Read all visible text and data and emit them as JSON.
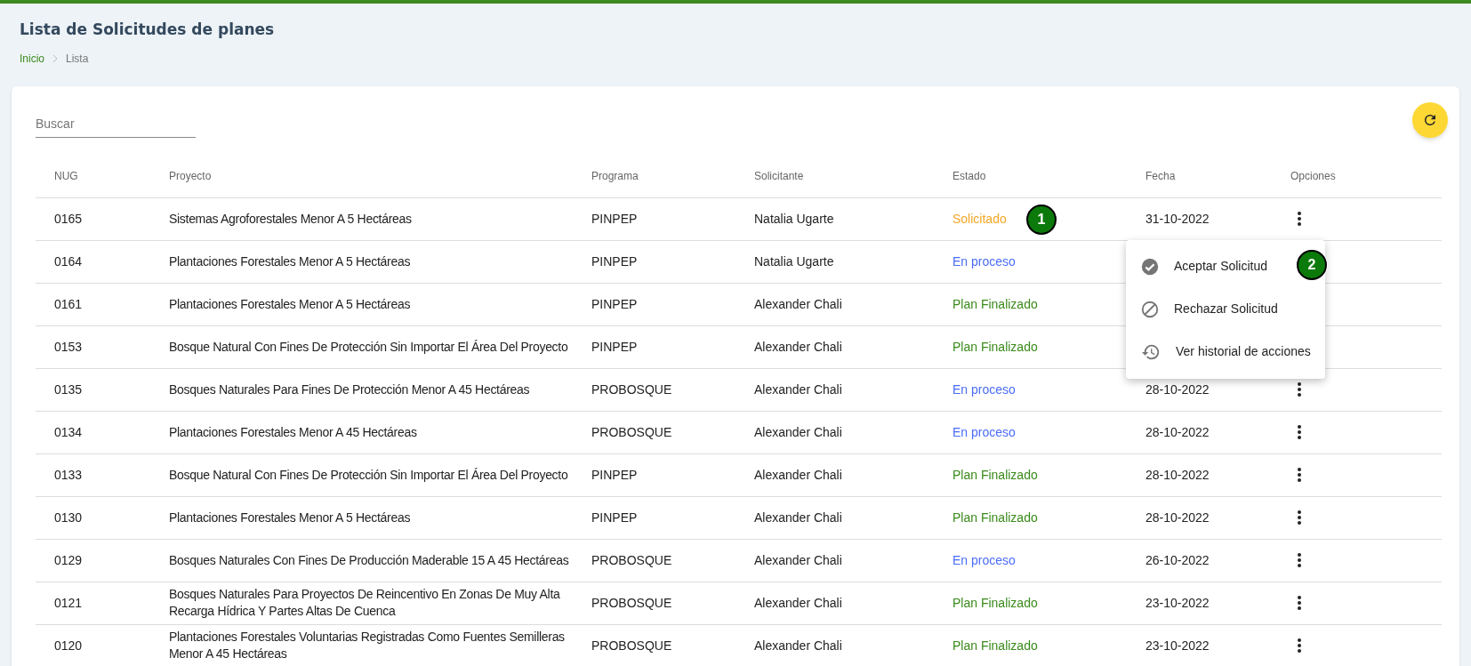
{
  "page": {
    "title": "Lista de Solicitudes de planes",
    "breadcrumb": [
      {
        "label": "Inicio",
        "kind": "link"
      },
      {
        "label": "Lista",
        "kind": "current"
      }
    ]
  },
  "search": {
    "placeholder": "Buscar"
  },
  "table": {
    "columns": [
      "NUG",
      "Proyecto",
      "Programa",
      "Solicitante",
      "Estado",
      "Fecha",
      "Opciones"
    ],
    "rows": [
      {
        "nug": "0165",
        "proyecto": "Sistemas Agroforestales Menor A 5 Hectáreas",
        "programa": "PINPEP",
        "solicitante": "Natalia Ugarte",
        "estado": {
          "label": "Solicitado",
          "kind": "solicitado"
        },
        "fecha": "31-10-2022"
      },
      {
        "nug": "0164",
        "proyecto": "Plantaciones Forestales Menor A 5 Hectáreas",
        "programa": "PINPEP",
        "solicitante": "Natalia Ugarte",
        "estado": {
          "label": "En proceso",
          "kind": "proceso"
        }
      },
      {
        "nug": "0161",
        "proyecto": "Plantaciones Forestales Menor A 5 Hectáreas",
        "programa": "PINPEP",
        "solicitante": "Alexander Chali",
        "estado": {
          "label": "Plan Finalizado",
          "kind": "finalizado"
        }
      },
      {
        "nug": "0153",
        "proyecto": "Bosque Natural Con Fines De Protección Sin Importar El Área Del Proyecto",
        "programa": "PINPEP",
        "solicitante": "Alexander Chali",
        "estado": {
          "label": "Plan Finalizado",
          "kind": "finalizado"
        }
      },
      {
        "nug": "0135",
        "proyecto": "Bosques Naturales Para Fines De Protección Menor A 45 Hectáreas",
        "programa": "PROBOSQUE",
        "solicitante": "Alexander Chali",
        "estado": {
          "label": "En proceso",
          "kind": "proceso"
        },
        "fecha": "28-10-2022"
      },
      {
        "nug": "0134",
        "proyecto": "Plantaciones Forestales Menor A 45 Hectáreas",
        "programa": "PROBOSQUE",
        "solicitante": "Alexander Chali",
        "estado": {
          "label": "En proceso",
          "kind": "proceso"
        },
        "fecha": "28-10-2022"
      },
      {
        "nug": "0133",
        "proyecto": "Bosque Natural Con Fines De Protección Sin Importar El Área Del Proyecto",
        "programa": "PINPEP",
        "solicitante": "Alexander Chali",
        "estado": {
          "label": "Plan Finalizado",
          "kind": "finalizado"
        },
        "fecha": "28-10-2022"
      },
      {
        "nug": "0130",
        "proyecto": "Plantaciones Forestales Menor A 5 Hectáreas",
        "programa": "PINPEP",
        "solicitante": "Alexander Chali",
        "estado": {
          "label": "Plan Finalizado",
          "kind": "finalizado"
        },
        "fecha": "28-10-2022"
      },
      {
        "nug": "0129",
        "proyecto": "Bosques Naturales Con Fines De Producción Maderable 15 A 45 Hectáreas",
        "programa": "PROBOSQUE",
        "solicitante": "Alexander Chali",
        "estado": {
          "label": "En proceso",
          "kind": "proceso"
        },
        "fecha": "26-10-2022"
      },
      {
        "nug": "0121",
        "proyecto": "Bosques Naturales Para Proyectos De Reincentivo En Zonas De Muy Alta Recarga Hídrica Y Partes Altas De Cuenca",
        "programa": "PROBOSQUE",
        "solicitante": "Alexander Chali",
        "estado": {
          "label": "Plan Finalizado",
          "kind": "finalizado"
        },
        "fecha": "23-10-2022"
      },
      {
        "nug": "0120",
        "proyecto": "Plantaciones Forestales Voluntarias Registradas Como Fuentes Semilleras Menor A 45 Hectáreas",
        "programa": "PROBOSQUE",
        "solicitante": "Alexander Chali",
        "estado": {
          "label": "Plan Finalizado",
          "kind": "finalizado"
        },
        "fecha": "23-10-2022"
      }
    ]
  },
  "options_menu": {
    "items": [
      {
        "label": "Aceptar Solicitud",
        "kind": "accept"
      },
      {
        "label": "Rechazar Solicitud",
        "kind": "reject"
      },
      {
        "label": "Ver historial de acciones",
        "kind": "history"
      }
    ]
  },
  "annotations": [
    {
      "label": "1",
      "kind": "status"
    },
    {
      "label": "2",
      "kind": "menu"
    }
  ]
}
